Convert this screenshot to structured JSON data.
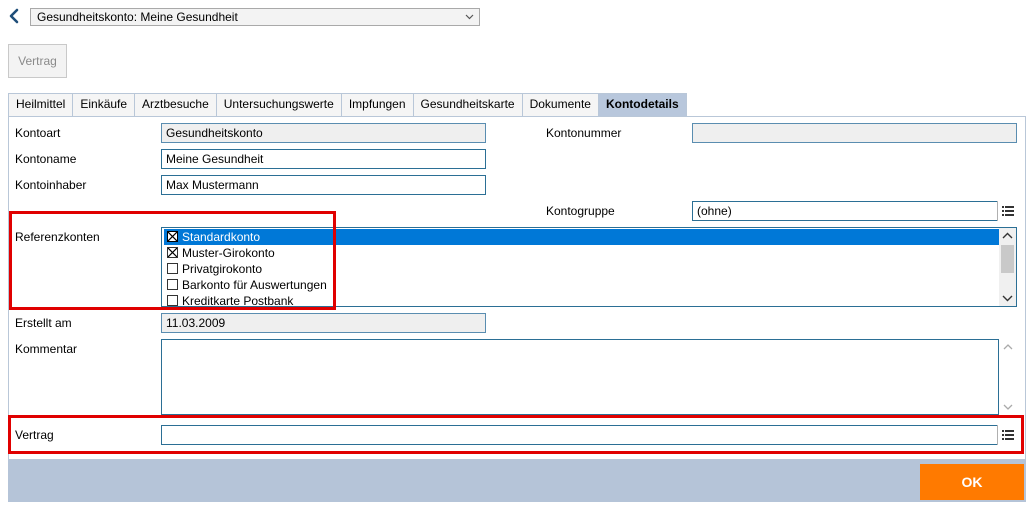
{
  "header": {
    "account_select": "Gesundheitskonto: Meine Gesundheit",
    "vertrag_button": "Vertrag"
  },
  "tabs": [
    {
      "label": "Heilmittel"
    },
    {
      "label": "Einkäufe"
    },
    {
      "label": "Arztbesuche"
    },
    {
      "label": "Untersuchungswerte"
    },
    {
      "label": "Impfungen"
    },
    {
      "label": "Gesundheitskarte"
    },
    {
      "label": "Dokumente"
    },
    {
      "label": "Kontodetails",
      "active": true
    }
  ],
  "form": {
    "kontoart_label": "Kontoart",
    "kontoart_value": "Gesundheitskonto",
    "kontoname_label": "Kontoname",
    "kontoname_value": "Meine Gesundheit",
    "kontoinhaber_label": "Kontoinhaber",
    "kontoinhaber_value": "Max Mustermann",
    "kontonummer_label": "Kontonummer",
    "kontonummer_value": "",
    "kontogruppe_label": "Kontogruppe",
    "kontogruppe_value": "(ohne)",
    "referenzkonten_label": "Referenzkonten",
    "referenzkonten": [
      {
        "label": "Standardkonto",
        "checked": true,
        "selected": true
      },
      {
        "label": "Muster-Girokonto",
        "checked": true,
        "selected": false
      },
      {
        "label": "Privatgirokonto",
        "checked": false,
        "selected": false
      },
      {
        "label": "Barkonto für Auswertungen",
        "checked": false,
        "selected": false
      },
      {
        "label": "Kreditkarte Postbank",
        "checked": false,
        "selected": false
      }
    ],
    "erstellt_label": "Erstellt am",
    "erstellt_value": "11.03.2009",
    "kommentar_label": "Kommentar",
    "kommentar_value": "",
    "vertrag_label": "Vertrag",
    "vertrag_value": ""
  },
  "footer": {
    "ok_label": "OK"
  },
  "colors": {
    "accent_orange": "#ff7a00",
    "highlight_red": "#e00000",
    "selection_blue": "#0078d7",
    "tab_active": "#b8c7dc"
  }
}
